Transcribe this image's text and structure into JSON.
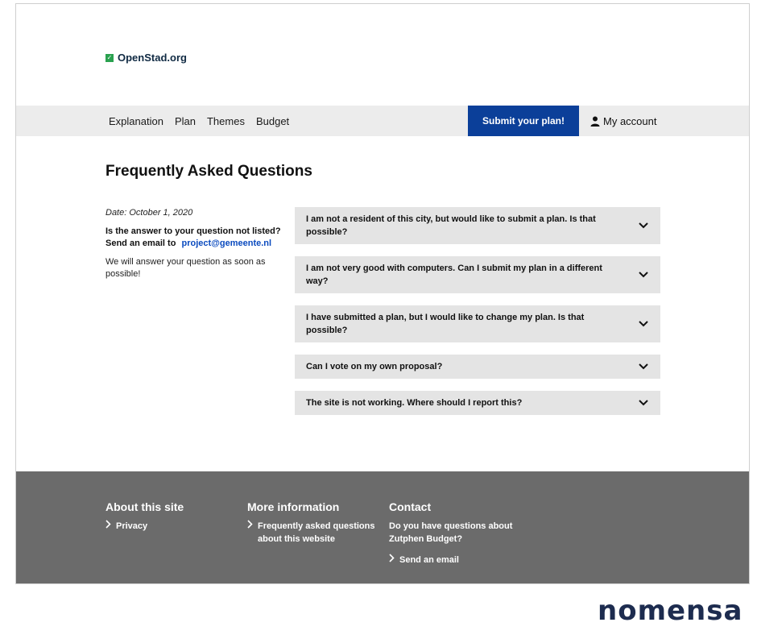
{
  "brand": {
    "name": "OpenStad.org",
    "check_glyph": "✓"
  },
  "nav": {
    "links": [
      "Explanation",
      "Plan",
      "Themes",
      "Budget"
    ],
    "submit_label": "Submit your plan!",
    "account_label": "My account"
  },
  "page": {
    "title": "Frequently Asked Questions"
  },
  "sidebar": {
    "date": "Date: October 1, 2020",
    "question": "Is the answer to your question not listed?",
    "email_prefix": "Send an email to",
    "email": "project@gemeente.nl",
    "answer_note": "We will answer your question as soon as possible!"
  },
  "faq": [
    {
      "question": "I am not a resident of this city, but would like to submit a plan. Is that possible?",
      "expanded": false
    },
    {
      "question": "I am not very good with computers. Can I submit my plan in a different way?",
      "expanded": false
    },
    {
      "question": "I have submitted a plan, but I would like to change my plan. Is that possible?",
      "expanded": false
    },
    {
      "question": "Can I vote on my own proposal?",
      "expanded": false
    },
    {
      "question": "The site is not working. Where should I report this?",
      "expanded": false
    }
  ],
  "footer": {
    "about": {
      "heading": "About this site",
      "links": [
        "Privacy"
      ]
    },
    "more": {
      "heading": "More information",
      "links": [
        "Frequently asked questions about this website"
      ]
    },
    "contact": {
      "heading": "Contact",
      "text": "Do you have questions about Zutphen Budget?",
      "link": "Send an email"
    }
  },
  "watermark": {
    "logo_text": "nomensa"
  },
  "colors": {
    "nav_bg": "#ececec",
    "accent": "#0b3f99",
    "faq_bg": "#e4e4e4",
    "footer_bg": "#6b6b6b",
    "link": "#0b4bbf",
    "brand_green": "#2aa14f"
  }
}
